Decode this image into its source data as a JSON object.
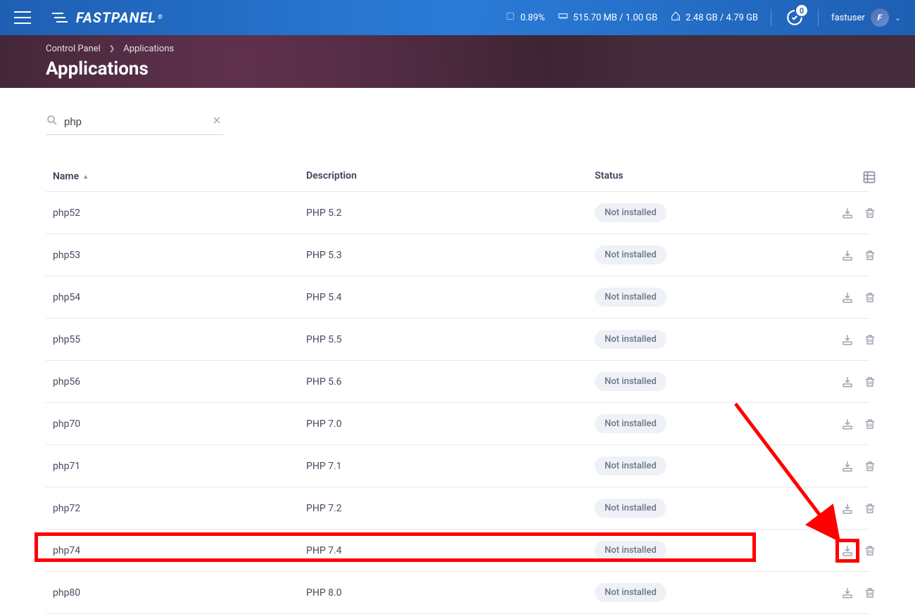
{
  "topbar": {
    "logo_text": "FASTPANEL",
    "stats": {
      "cpu": "0.89%",
      "ram": "515.70 MB / 1.00 GB",
      "disk": "2.48 GB / 4.79 GB"
    },
    "tasks_count": "0",
    "username": "fastuser",
    "avatar_letter": "F"
  },
  "breadcrumb": {
    "root": "Control Panel",
    "current": "Applications"
  },
  "page_title": "Applications",
  "search": {
    "value": "php"
  },
  "table": {
    "columns": {
      "name": "Name",
      "description": "Description",
      "status": "Status"
    },
    "rows": [
      {
        "name": "php52",
        "description": "PHP 5.2",
        "status": "Not installed"
      },
      {
        "name": "php53",
        "description": "PHP 5.3",
        "status": "Not installed"
      },
      {
        "name": "php54",
        "description": "PHP 5.4",
        "status": "Not installed"
      },
      {
        "name": "php55",
        "description": "PHP 5.5",
        "status": "Not installed"
      },
      {
        "name": "php56",
        "description": "PHP 5.6",
        "status": "Not installed"
      },
      {
        "name": "php70",
        "description": "PHP 7.0",
        "status": "Not installed"
      },
      {
        "name": "php71",
        "description": "PHP 7.1",
        "status": "Not installed"
      },
      {
        "name": "php72",
        "description": "PHP 7.2",
        "status": "Not installed"
      },
      {
        "name": "php74",
        "description": "PHP 7.4",
        "status": "Not installed"
      },
      {
        "name": "php80",
        "description": "PHP 8.0",
        "status": "Not installed"
      }
    ]
  },
  "annotation_highlight_row_index": 8
}
